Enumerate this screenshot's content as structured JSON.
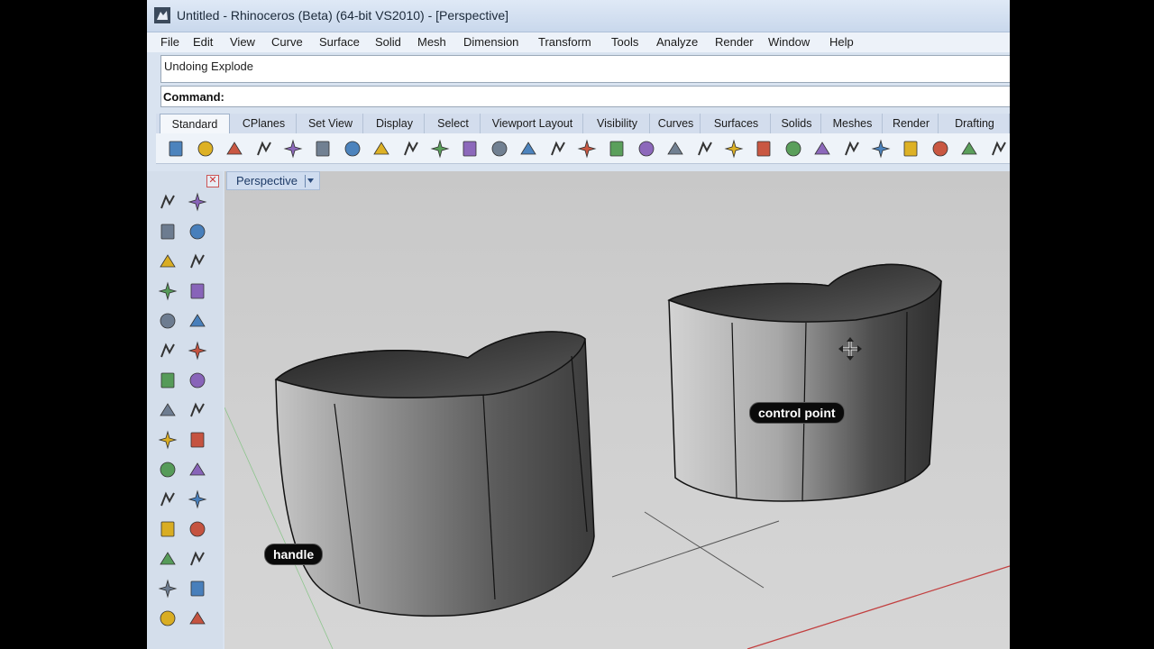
{
  "window": {
    "title": "Untitled - Rhinoceros (Beta) (64-bit VS2010) - [Perspective]"
  },
  "menu": [
    "File",
    "Edit",
    "View",
    "Curve",
    "Surface",
    "Solid",
    "Mesh",
    "Dimension",
    "Transform",
    "Tools",
    "Analyze",
    "Render",
    "Window",
    "Help"
  ],
  "command": {
    "history": "Undoing Explode",
    "prompt": "Command:"
  },
  "toolbar_tabs": [
    "Standard",
    "CPlanes",
    "Set View",
    "Display",
    "Select",
    "Viewport Layout",
    "Visibility",
    "Curves",
    "Surfaces",
    "Solids",
    "Meshes",
    "Render",
    "Drafting"
  ],
  "toolbar_icons": [
    "new-file-icon",
    "open-folder-icon",
    "save-icon",
    "print-icon",
    "import-icon",
    "cut-icon",
    "copy-icon",
    "paste-icon",
    "undo-icon",
    "pan-hand-icon",
    "move-view-icon",
    "zoom-icon",
    "zoom-window-icon",
    "zoom-extents-icon",
    "zoom-selected-icon",
    "rotate-view-icon",
    "four-viewports-icon",
    "car-icon",
    "hide-icon",
    "show-icon",
    "lights-icon",
    "bulb-icon",
    "lock-icon",
    "layer-icon",
    "color-wheel-icon",
    "render-sphere-icon",
    "material-sphere-icon",
    "blue-sphere-icon",
    "settings-icon"
  ],
  "sidebar_icons": [
    "select-arrow-icon",
    "point-icon",
    "polyline-icon",
    "curve-icon",
    "circle-icon",
    "ellipse-icon",
    "polygon-icon",
    "rectangle-icon",
    "arc-icon",
    "fillet-curve-icon",
    "surface-icon",
    "revolve-icon",
    "box-icon",
    "sphere-icon",
    "cylinder-icon",
    "pipe-icon",
    "boolean-icon",
    "explode-icon",
    "trim-icon",
    "split-icon",
    "group-icon",
    "block-icon",
    "blend-icon",
    "rotate-icon",
    "text-icon",
    "scale-icon",
    "grid-icon",
    "edit-icon",
    "solid-box-icon",
    "dimension-icon",
    "array-icon",
    "mesh-icon"
  ],
  "viewport": {
    "label": "Perspective"
  },
  "callouts": {
    "handle": "handle",
    "control_point": "control point"
  },
  "colors": {
    "title_bar": "#c9d8ec",
    "viewport_bg": "#cfcfcf",
    "callout_bg": "#0a0a0a"
  }
}
